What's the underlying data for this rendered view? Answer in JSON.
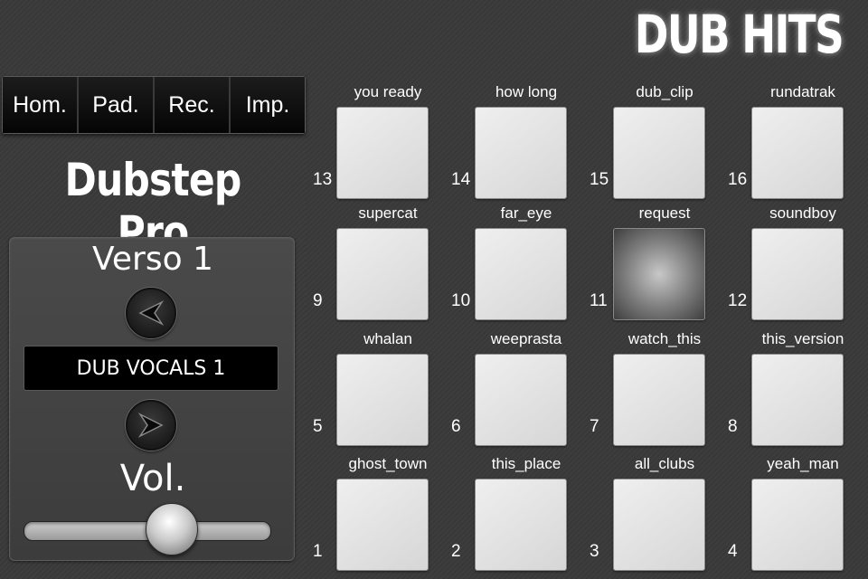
{
  "app": {
    "brand": "DUB HITS",
    "title": "Dubstep Pro"
  },
  "nav": [
    {
      "label": "Hom."
    },
    {
      "label": "Pad."
    },
    {
      "label": "Rec."
    },
    {
      "label": "Imp."
    }
  ],
  "controls": {
    "verse_label": "Verso 1",
    "prev_icon": "left-arrow-icon",
    "next_icon": "right-arrow-icon",
    "sound_bank": "DUB VOCALS 1",
    "volume_label": "Vol.",
    "volume_level": 0.6
  },
  "pads": [
    {
      "number": "13",
      "name": "you ready",
      "active": false
    },
    {
      "number": "14",
      "name": "how long",
      "active": false
    },
    {
      "number": "15",
      "name": "dub_clip",
      "active": false
    },
    {
      "number": "16",
      "name": "rundatrak",
      "active": false
    },
    {
      "number": "9",
      "name": "supercat",
      "active": false
    },
    {
      "number": "10",
      "name": "far_eye",
      "active": false
    },
    {
      "number": "11",
      "name": "request",
      "active": true
    },
    {
      "number": "12",
      "name": "soundboy",
      "active": false
    },
    {
      "number": "5",
      "name": "whalan",
      "active": false
    },
    {
      "number": "6",
      "name": "weeprasta",
      "active": false
    },
    {
      "number": "7",
      "name": "watch_this",
      "active": false
    },
    {
      "number": "8",
      "name": "this_version",
      "active": false
    },
    {
      "number": "1",
      "name": "ghost_town",
      "active": false
    },
    {
      "number": "2",
      "name": "this_place",
      "active": false
    },
    {
      "number": "3",
      "name": "all_clubs",
      "active": false
    },
    {
      "number": "4",
      "name": "yeah_man",
      "active": false
    }
  ]
}
